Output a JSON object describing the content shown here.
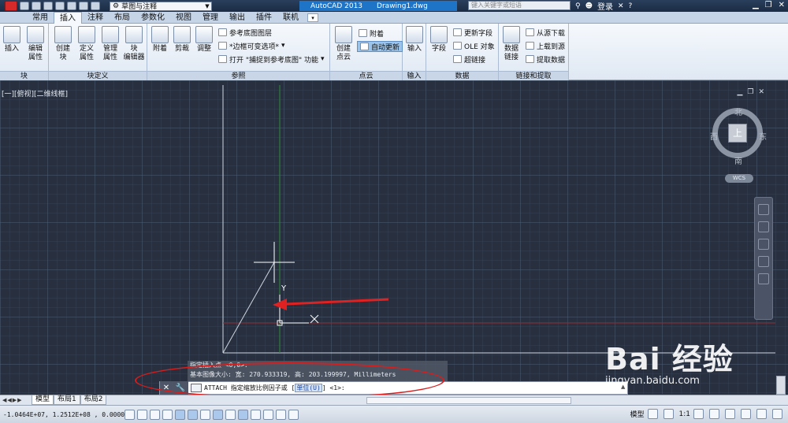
{
  "titlebar": {
    "workspace": "草图与注释",
    "app_title": "AutoCAD 2013",
    "doc_title": "Drawing1.dwg",
    "search_placeholder": "键入关键字或短语",
    "login": "登录"
  },
  "ribbon_tabs": [
    "常用",
    "插入",
    "注释",
    "布局",
    "参数化",
    "视图",
    "管理",
    "输出",
    "插件",
    "联机"
  ],
  "panels": {
    "block": {
      "title": "块",
      "items": [
        "插入",
        "编辑\n属性"
      ]
    },
    "block_def": {
      "title": "块定义",
      "items": [
        "创建\n块",
        "定义\n属性",
        "管理\n属性",
        "块\n编辑器"
      ]
    },
    "reference": {
      "title": "参照",
      "items": [
        "附着",
        "剪裁",
        "调整"
      ],
      "small": [
        "参考底图图层",
        "*边框可变选项*",
        "打开 \"捕捉到参考底图\" 功能"
      ]
    },
    "pointcloud": {
      "title": "点云",
      "items": [
        "创建\n点云"
      ],
      "small": [
        "附着",
        "自动更新"
      ]
    },
    "import": {
      "title": "输入",
      "items": [
        "输入"
      ]
    },
    "data": {
      "title": "数据",
      "items": [
        "字段"
      ],
      "small": [
        "更新字段",
        "OLE 对象",
        "超链接"
      ]
    },
    "linking": {
      "title": "链接和提取",
      "items": [
        "数据\n链接"
      ],
      "small": [
        "从源下载",
        "上载到源",
        "提取数据"
      ]
    }
  },
  "viewport": {
    "label": "[一][俯视][二维线框]",
    "viewcube": {
      "top": "上",
      "north": "北",
      "south": "南",
      "east": "东",
      "west": "西",
      "wcs": "WCS"
    },
    "ucs_y": "Y"
  },
  "command": {
    "history": [
      "指定插入点 <0,0>:",
      "基本图像大小: 宽: 270.933319, 高: 203.199997, Millimeters"
    ],
    "prompt": "ATTACH 指定缩放比例因子或 [",
    "option": "单位(U)",
    "suffix": "] <1>:"
  },
  "layout_tabs": [
    "模型",
    "布局1",
    "布局2"
  ],
  "statusbar": {
    "coords": "-1.0464E+07,  1.2512E+08 , 0.0000",
    "model": "模型",
    "scale": "1:1"
  },
  "watermark": {
    "main": "Bai 经验",
    "url": "jingyan.baidu.com"
  },
  "colors": {
    "canvas": "#283040",
    "annotation": "#d81d1d"
  }
}
